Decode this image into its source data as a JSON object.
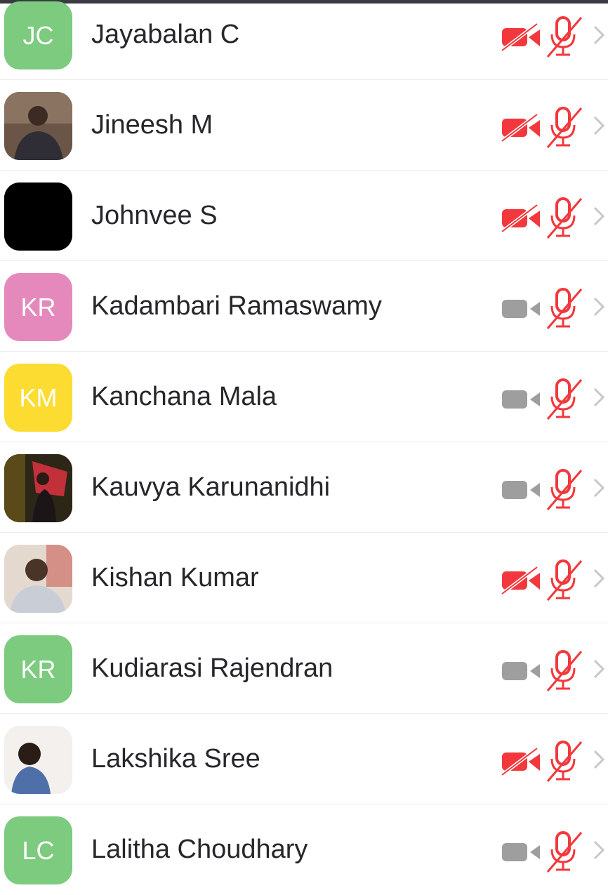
{
  "participants": [
    {
      "name": "Jayabalan C",
      "initials": "JC",
      "avatar_color": "#7ccb7f",
      "avatar_type": "initials",
      "video": "off-red",
      "audio": "muted"
    },
    {
      "name": "Jineesh M",
      "initials": "",
      "avatar_color": "#5b4a3e",
      "avatar_type": "photo",
      "video": "off-red",
      "audio": "muted"
    },
    {
      "name": "Johnvee S",
      "initials": "",
      "avatar_color": "#000000",
      "avatar_type": "photo",
      "video": "off-red",
      "audio": "muted"
    },
    {
      "name": "Kadambari Ramaswamy",
      "initials": "KR",
      "avatar_color": "#e589bd",
      "avatar_type": "initials",
      "video": "off-gray",
      "audio": "muted"
    },
    {
      "name": "Kanchana Mala",
      "initials": "KM",
      "avatar_color": "#fddc32",
      "avatar_type": "initials",
      "video": "off-gray",
      "audio": "muted"
    },
    {
      "name": "Kauvya Karunanidhi",
      "initials": "",
      "avatar_color": "#2e2a18",
      "avatar_type": "photo",
      "video": "off-gray",
      "audio": "muted"
    },
    {
      "name": "Kishan Kumar",
      "initials": "",
      "avatar_color": "#d9cfc6",
      "avatar_type": "photo",
      "video": "off-red",
      "audio": "muted"
    },
    {
      "name": "Kudiarasi Rajendran",
      "initials": "KR",
      "avatar_color": "#7ccb7f",
      "avatar_type": "initials",
      "video": "off-gray",
      "audio": "muted"
    },
    {
      "name": "Lakshika Sree",
      "initials": "",
      "avatar_color": "#f2efec",
      "avatar_type": "photo",
      "video": "off-red",
      "audio": "muted"
    },
    {
      "name": "Lalitha Choudhary",
      "initials": "LC",
      "avatar_color": "#7ccb7f",
      "avatar_type": "initials",
      "video": "off-gray",
      "audio": "muted"
    }
  ],
  "colors": {
    "red": "#f2383c",
    "gray": "#9e9e9e",
    "chevron": "#c7c7cc",
    "divider": "#ececec",
    "text": "#26262b"
  },
  "icons": {
    "video_off": "video-off-icon",
    "mic_muted": "mic-muted-icon",
    "chevron": "chevron-right-icon"
  }
}
